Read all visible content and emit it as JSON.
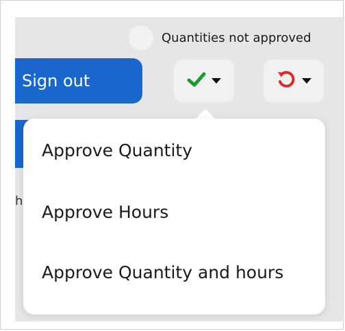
{
  "status": {
    "text": "Quantities not approved"
  },
  "toolbar": {
    "signout_label": "Sign out",
    "approve_icon": "check-icon",
    "revert_icon": "undo-icon",
    "approve_color": "#1a9b2f",
    "revert_color": "#d92b2b",
    "accent_color": "#1967cc"
  },
  "menu": {
    "items": [
      {
        "label": "Approve Quantity"
      },
      {
        "label": "Approve Hours"
      },
      {
        "label": "Approve Quantity and hours"
      }
    ]
  },
  "background": {
    "side_fragment": "h"
  }
}
